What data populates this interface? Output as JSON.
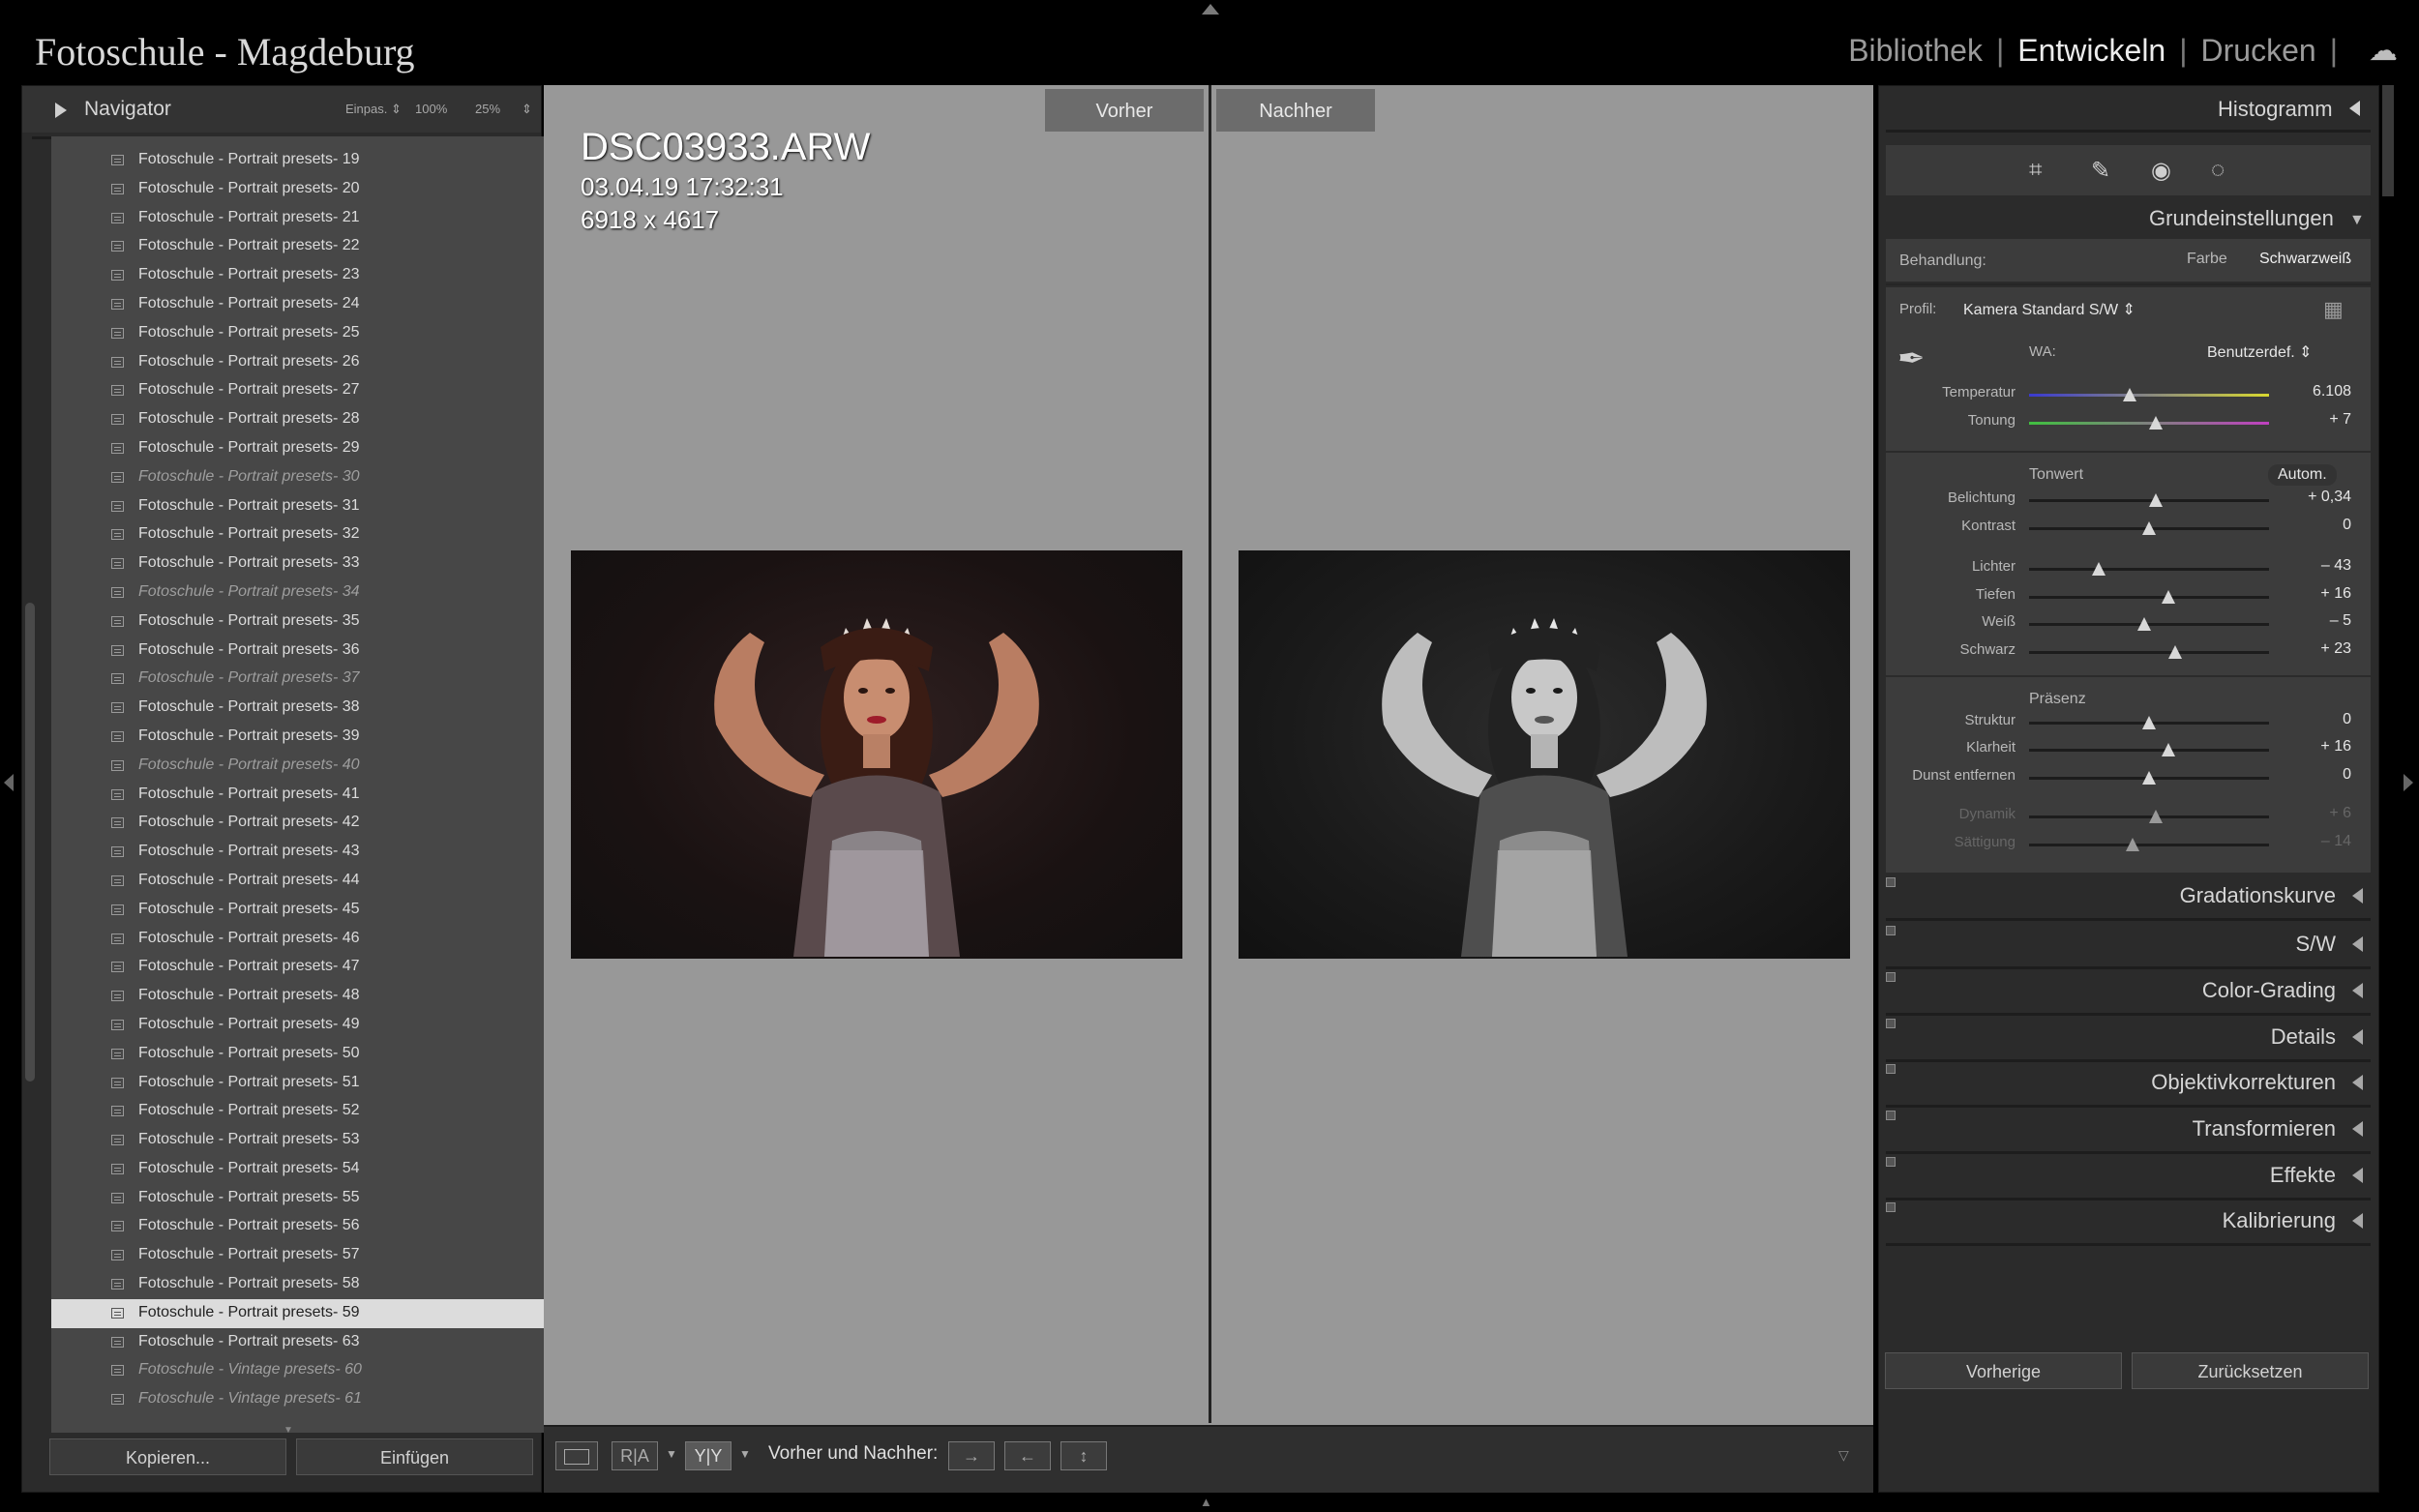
{
  "header": {
    "catalog_title": "Fotoschule - Magdeburg",
    "modules": [
      "Bibliothek",
      "Entwickeln",
      "Drucken"
    ],
    "active_module": "Entwickeln",
    "cloud_icon": "cloud-icon"
  },
  "navigator": {
    "title": "Navigator",
    "zoom_fit": "Einpas.",
    "zoom_100": "100%",
    "zoom_25": "25%"
  },
  "presets": [
    {
      "label": "Fotoschule - Portrait presets- 19",
      "italic": false,
      "selected": false
    },
    {
      "label": "Fotoschule - Portrait presets- 20",
      "italic": false,
      "selected": false
    },
    {
      "label": "Fotoschule - Portrait presets- 21",
      "italic": false,
      "selected": false
    },
    {
      "label": "Fotoschule - Portrait presets- 22",
      "italic": false,
      "selected": false
    },
    {
      "label": "Fotoschule - Portrait presets- 23",
      "italic": false,
      "selected": false
    },
    {
      "label": "Fotoschule - Portrait presets- 24",
      "italic": false,
      "selected": false
    },
    {
      "label": "Fotoschule - Portrait presets- 25",
      "italic": false,
      "selected": false
    },
    {
      "label": "Fotoschule - Portrait presets- 26",
      "italic": false,
      "selected": false
    },
    {
      "label": "Fotoschule - Portrait presets- 27",
      "italic": false,
      "selected": false
    },
    {
      "label": "Fotoschule - Portrait presets- 28",
      "italic": false,
      "selected": false
    },
    {
      "label": "Fotoschule - Portrait presets- 29",
      "italic": false,
      "selected": false
    },
    {
      "label": "Fotoschule - Portrait presets- 30",
      "italic": true,
      "selected": false
    },
    {
      "label": "Fotoschule - Portrait presets- 31",
      "italic": false,
      "selected": false
    },
    {
      "label": "Fotoschule - Portrait presets- 32",
      "italic": false,
      "selected": false
    },
    {
      "label": "Fotoschule - Portrait presets- 33",
      "italic": false,
      "selected": false
    },
    {
      "label": "Fotoschule - Portrait presets- 34",
      "italic": true,
      "selected": false
    },
    {
      "label": "Fotoschule - Portrait presets- 35",
      "italic": false,
      "selected": false
    },
    {
      "label": "Fotoschule - Portrait presets- 36",
      "italic": false,
      "selected": false
    },
    {
      "label": "Fotoschule - Portrait presets- 37",
      "italic": true,
      "selected": false
    },
    {
      "label": "Fotoschule - Portrait presets- 38",
      "italic": false,
      "selected": false
    },
    {
      "label": "Fotoschule - Portrait presets- 39",
      "italic": false,
      "selected": false
    },
    {
      "label": "Fotoschule - Portrait presets- 40",
      "italic": true,
      "selected": false
    },
    {
      "label": "Fotoschule - Portrait presets- 41",
      "italic": false,
      "selected": false
    },
    {
      "label": "Fotoschule - Portrait presets- 42",
      "italic": false,
      "selected": false
    },
    {
      "label": "Fotoschule - Portrait presets- 43",
      "italic": false,
      "selected": false
    },
    {
      "label": "Fotoschule - Portrait presets- 44",
      "italic": false,
      "selected": false
    },
    {
      "label": "Fotoschule - Portrait presets- 45",
      "italic": false,
      "selected": false
    },
    {
      "label": "Fotoschule - Portrait presets- 46",
      "italic": false,
      "selected": false
    },
    {
      "label": "Fotoschule - Portrait presets- 47",
      "italic": false,
      "selected": false
    },
    {
      "label": "Fotoschule - Portrait presets- 48",
      "italic": false,
      "selected": false
    },
    {
      "label": "Fotoschule - Portrait presets- 49",
      "italic": false,
      "selected": false
    },
    {
      "label": "Fotoschule - Portrait presets- 50",
      "italic": false,
      "selected": false
    },
    {
      "label": "Fotoschule - Portrait presets- 51",
      "italic": false,
      "selected": false
    },
    {
      "label": "Fotoschule - Portrait presets- 52",
      "italic": false,
      "selected": false
    },
    {
      "label": "Fotoschule - Portrait presets- 53",
      "italic": false,
      "selected": false
    },
    {
      "label": "Fotoschule - Portrait presets- 54",
      "italic": false,
      "selected": false
    },
    {
      "label": "Fotoschule - Portrait presets- 55",
      "italic": false,
      "selected": false
    },
    {
      "label": "Fotoschule - Portrait presets- 56",
      "italic": false,
      "selected": false
    },
    {
      "label": "Fotoschule - Portrait presets- 57",
      "italic": false,
      "selected": false
    },
    {
      "label": "Fotoschule - Portrait presets- 58",
      "italic": false,
      "selected": false
    },
    {
      "label": "Fotoschule - Portrait presets- 59",
      "italic": false,
      "selected": true
    },
    {
      "label": "Fotoschule - Portrait presets- 63",
      "italic": false,
      "selected": false
    },
    {
      "label": "Fotoschule - Vintage presets- 60",
      "italic": true,
      "selected": false
    },
    {
      "label": "Fotoschule - Vintage presets- 61",
      "italic": true,
      "selected": false
    }
  ],
  "left_buttons": {
    "copy": "Kopieren...",
    "paste": "Einfügen"
  },
  "view": {
    "before_label": "Vorher",
    "after_label": "Nachher",
    "filename": "DSC03933.ARW",
    "datetime": "03.04.19 17:32:31",
    "dimensions": "6918 x 4617"
  },
  "toolbar": {
    "view_ra": "R|A",
    "view_yy": "Y|Y",
    "before_after_label": "Vorher und Nachher:"
  },
  "right": {
    "histogram": "Histogramm",
    "basic_title": "Grundeinstellungen",
    "treatment_label": "Behandlung:",
    "treatment_color": "Farbe",
    "treatment_bw": "Schwarzweiß",
    "profile_label": "Profil:",
    "profile_value": "Kamera Standard S/W",
    "wb_label": "WA:",
    "wb_value": "Benutzerdef.",
    "tone_label": "Tonwert",
    "auto_label": "Autom.",
    "presence_label": "Präsenz"
  },
  "sliders": {
    "temperatur": {
      "label": "Temperatur",
      "value": "6.108",
      "pos": 0.42
    },
    "tonung": {
      "label": "Tonung",
      "value": "+ 7",
      "pos": 0.53
    },
    "belichtung": {
      "label": "Belichtung",
      "value": "+ 0,34",
      "pos": 0.53
    },
    "kontrast": {
      "label": "Kontrast",
      "value": "0",
      "pos": 0.5
    },
    "lichter": {
      "label": "Lichter",
      "value": "– 43",
      "pos": 0.29
    },
    "tiefen": {
      "label": "Tiefen",
      "value": "+ 16",
      "pos": 0.58
    },
    "weiss": {
      "label": "Weiß",
      "value": "– 5",
      "pos": 0.48
    },
    "schwarz": {
      "label": "Schwarz",
      "value": "+ 23",
      "pos": 0.61
    },
    "struktur": {
      "label": "Struktur",
      "value": "0",
      "pos": 0.5
    },
    "klarheit": {
      "label": "Klarheit",
      "value": "+ 16",
      "pos": 0.58
    },
    "dunst": {
      "label": "Dunst entfernen",
      "value": "0",
      "pos": 0.5
    },
    "dynamik": {
      "label": "Dynamik",
      "value": "+ 6",
      "pos": 0.53
    },
    "saettigung": {
      "label": "Sättigung",
      "value": "– 14",
      "pos": 0.43
    }
  },
  "panels": [
    "Gradationskurve",
    "S/W",
    "Color-Grading",
    "Details",
    "Objektivkorrekturen",
    "Transformieren",
    "Effekte",
    "Kalibrierung"
  ],
  "right_buttons": {
    "previous": "Vorherige",
    "reset": "Zurücksetzen"
  },
  "colors": {
    "temp_left": "#3a3ad0",
    "temp_right": "#d8d830",
    "tint_left": "#40c040",
    "tint_right": "#c040c0"
  }
}
